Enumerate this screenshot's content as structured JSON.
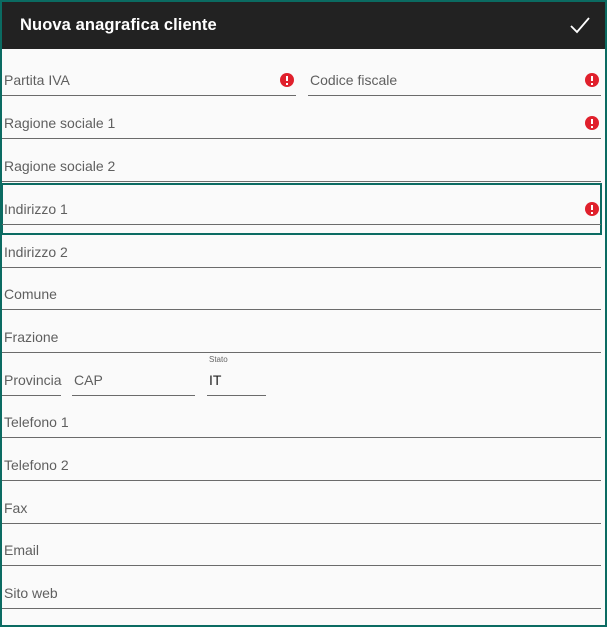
{
  "appbar": {
    "title": "Nuova anagrafica cliente",
    "confirm_icon": "check-icon"
  },
  "form": {
    "partita_iva": {
      "placeholder": "Partita IVA",
      "error": true
    },
    "codice_fiscale": {
      "placeholder": "Codice fiscale",
      "error": true
    },
    "ragione_sociale_1": {
      "placeholder": "Ragione sociale 1",
      "error": true
    },
    "ragione_sociale_2": {
      "placeholder": "Ragione sociale 2",
      "error": false
    },
    "indirizzo_1": {
      "placeholder": "Indirizzo 1",
      "error": true,
      "focused": true
    },
    "indirizzo_2": {
      "placeholder": "Indirizzo 2"
    },
    "comune": {
      "placeholder": "Comune"
    },
    "frazione": {
      "placeholder": "Frazione"
    },
    "provincia": {
      "placeholder": "Provincia"
    },
    "cap": {
      "placeholder": "CAP"
    },
    "stato": {
      "label": "Stato",
      "value": "IT"
    },
    "telefono_1": {
      "placeholder": "Telefono 1"
    },
    "telefono_2": {
      "placeholder": "Telefono 2"
    },
    "fax": {
      "placeholder": "Fax"
    },
    "email": {
      "placeholder": "Email"
    },
    "sito_web": {
      "placeholder": "Sito web"
    }
  },
  "colors": {
    "appbar_bg": "#222222",
    "accent_border": "#0b6b62",
    "error": "#e0202c"
  }
}
